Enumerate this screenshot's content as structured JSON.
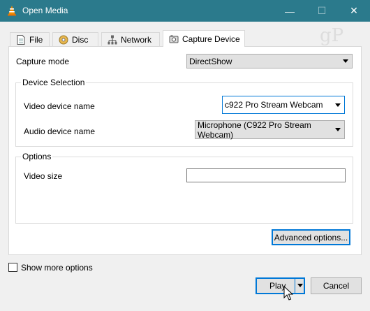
{
  "window": {
    "title": "Open Media",
    "controls": {
      "minimize": "—",
      "maximize": "☐",
      "close": "✕"
    },
    "watermark": "gP"
  },
  "tabs": [
    {
      "label": "File",
      "icon": "file-icon",
      "active": false
    },
    {
      "label": "Disc",
      "icon": "disc-icon",
      "active": false
    },
    {
      "label": "Network",
      "icon": "network-icon",
      "active": false
    },
    {
      "label": "Capture Device",
      "icon": "capture-device-icon",
      "active": true
    }
  ],
  "capture": {
    "mode_label": "Capture mode",
    "mode_value": "DirectShow"
  },
  "device_selection": {
    "title": "Device Selection",
    "video_label": "Video device name",
    "video_value": "c922 Pro Stream Webcam",
    "audio_label": "Audio device name",
    "audio_value": "Microphone (C922 Pro Stream Webcam)"
  },
  "options": {
    "title": "Options",
    "video_size_label": "Video size",
    "video_size_value": ""
  },
  "advanced_button": "Advanced options...",
  "show_more": {
    "label": "Show more options",
    "checked": false
  },
  "footer": {
    "play": "Play",
    "cancel": "Cancel"
  },
  "colors": {
    "titlebar": "#2b7a8c",
    "accent": "#0078d7"
  }
}
